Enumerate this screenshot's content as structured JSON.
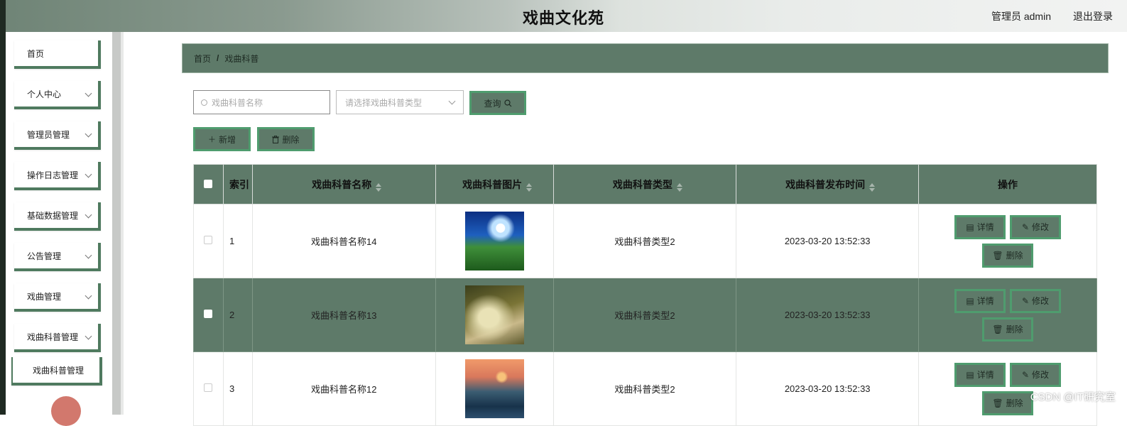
{
  "header": {
    "title": "戏曲文化苑",
    "user": "管理员 admin",
    "logout": "退出登录"
  },
  "sidebar": {
    "items": [
      {
        "label": "首页"
      },
      {
        "label": "个人中心"
      },
      {
        "label": "管理员管理"
      },
      {
        "label": "操作日志管理"
      },
      {
        "label": "基础数据管理"
      },
      {
        "label": "公告管理"
      },
      {
        "label": "戏曲管理"
      },
      {
        "label": "戏曲科普管理"
      }
    ],
    "subitem": "戏曲科普管理"
  },
  "breadcrumb": {
    "home": "首页",
    "separator": "/",
    "current": "戏曲科普"
  },
  "search": {
    "name_placeholder": "戏曲科普名称",
    "type_placeholder": "请选择戏曲科普类型",
    "query_label": "查询"
  },
  "toolbar": {
    "add_label": "新增",
    "delete_label": "删除"
  },
  "table": {
    "headers": {
      "index": "索引",
      "name": "戏曲科普名称",
      "image": "戏曲科普图片",
      "type": "戏曲科普类型",
      "time": "戏曲科普发布时间",
      "ops": "操作"
    },
    "rows": [
      {
        "index": "1",
        "name": "戏曲科普名称14",
        "type": "戏曲科普类型2",
        "time": "2023-03-20 13:52:33"
      },
      {
        "index": "2",
        "name": "戏曲科普名称13",
        "type": "戏曲科普类型2",
        "time": "2023-03-20 13:52:33"
      },
      {
        "index": "3",
        "name": "戏曲科普名称12",
        "type": "戏曲科普类型2",
        "time": "2023-03-20 13:52:33"
      }
    ],
    "actions": {
      "detail": "详情",
      "edit": "修改",
      "delete": "删除"
    }
  },
  "watermark": "CSDN @IT研究室",
  "colors": {
    "accent": "#5e7a69",
    "accent_border": "#4f9c6e"
  }
}
